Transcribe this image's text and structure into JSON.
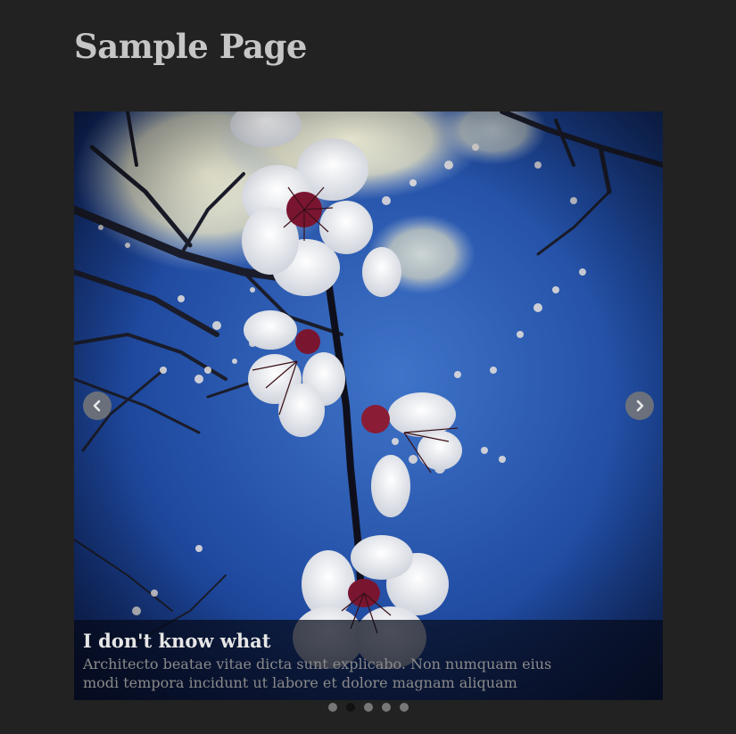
{
  "page": {
    "title": "Sample Page"
  },
  "slider": {
    "caption_title": "I don't know what",
    "caption_text_line1": "Architecto beatae vitae dicta sunt explicabo. Non numquam eius",
    "caption_text_line2": "modi tempora incidunt ut labore et dolore magnam aliquam",
    "prev_icon": "chevron-left-icon",
    "next_icon": "chevron-right-icon",
    "slide_count": 5,
    "active_slide": 2
  },
  "colors": {
    "background": "#222222",
    "title": "#c6c6c6",
    "sky_light": "#3d6fc4",
    "sky_dark": "#0e2260",
    "petal": "#f2f0ee",
    "flower_center": "#7a1530"
  }
}
